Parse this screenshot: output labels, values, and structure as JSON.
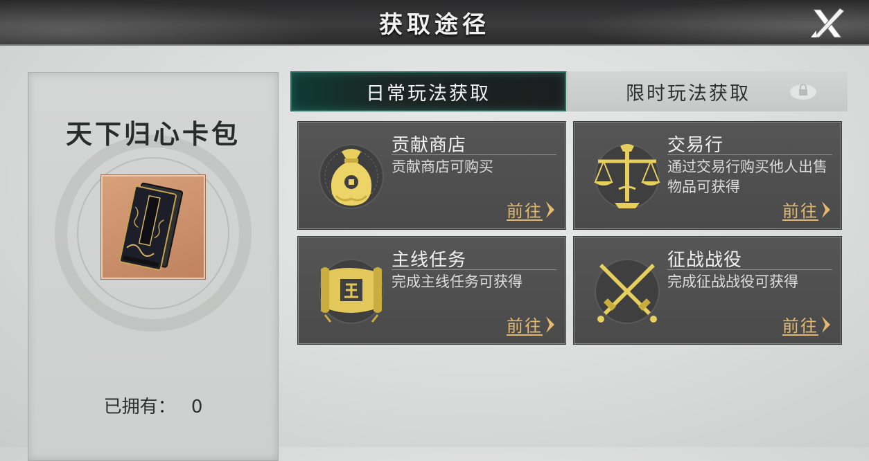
{
  "header": {
    "title": "获取途径"
  },
  "left_panel": {
    "card_name": "天下归心卡包",
    "owned_label": "已拥有：",
    "owned_count": "0"
  },
  "tabs": [
    {
      "label": "日常玩法获取",
      "active": true
    },
    {
      "label": "限时玩法获取",
      "active": false,
      "locked": true
    }
  ],
  "sources": [
    {
      "name": "贡献商店",
      "desc": "贡献商店可购买",
      "go_label": "前往",
      "icon": "money-bag-icon"
    },
    {
      "name": "交易行",
      "desc": "通过交易行购买他人出售物品可获得",
      "go_label": "前往",
      "icon": "scales-icon"
    },
    {
      "name": "主线任务",
      "desc": "完成主线任务可获得",
      "go_label": "前往",
      "icon": "scroll-icon"
    },
    {
      "name": "征战战役",
      "desc": "完成征战战役可获得",
      "go_label": "前往",
      "icon": "crossed-swords-icon"
    }
  ],
  "colors": {
    "accent_gold": "#e2b96f",
    "active_tab": "#0f3a34"
  }
}
